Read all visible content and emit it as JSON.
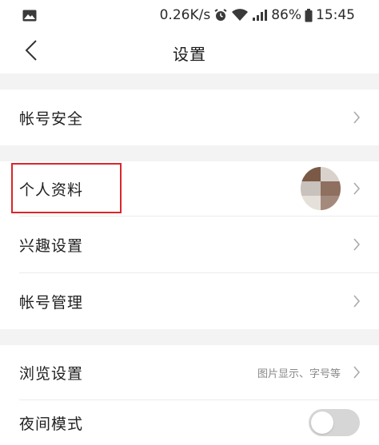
{
  "status_bar": {
    "speed": "0.26K/s",
    "battery": "86%",
    "time": "15:45",
    "icons": [
      "gallery-icon",
      "alarm-icon",
      "wifi-icon",
      "signal-icon",
      "battery-icon"
    ]
  },
  "nav": {
    "title": "设置",
    "back_icon": "chevron-left-icon"
  },
  "sections": {
    "account_security": {
      "label": "帐号安全"
    },
    "profile": {
      "label": "个人资料"
    },
    "interests": {
      "label": "兴趣设置"
    },
    "account_manage": {
      "label": "帐号管理"
    },
    "browse": {
      "label": "浏览设置",
      "value": "图片显示、字号等"
    },
    "night_mode": {
      "label": "夜间模式",
      "enabled": false
    }
  },
  "colors": {
    "highlight": "#d9262b",
    "section_gap": "#f3f3f3",
    "toggle_off": "#d6d6d6"
  }
}
